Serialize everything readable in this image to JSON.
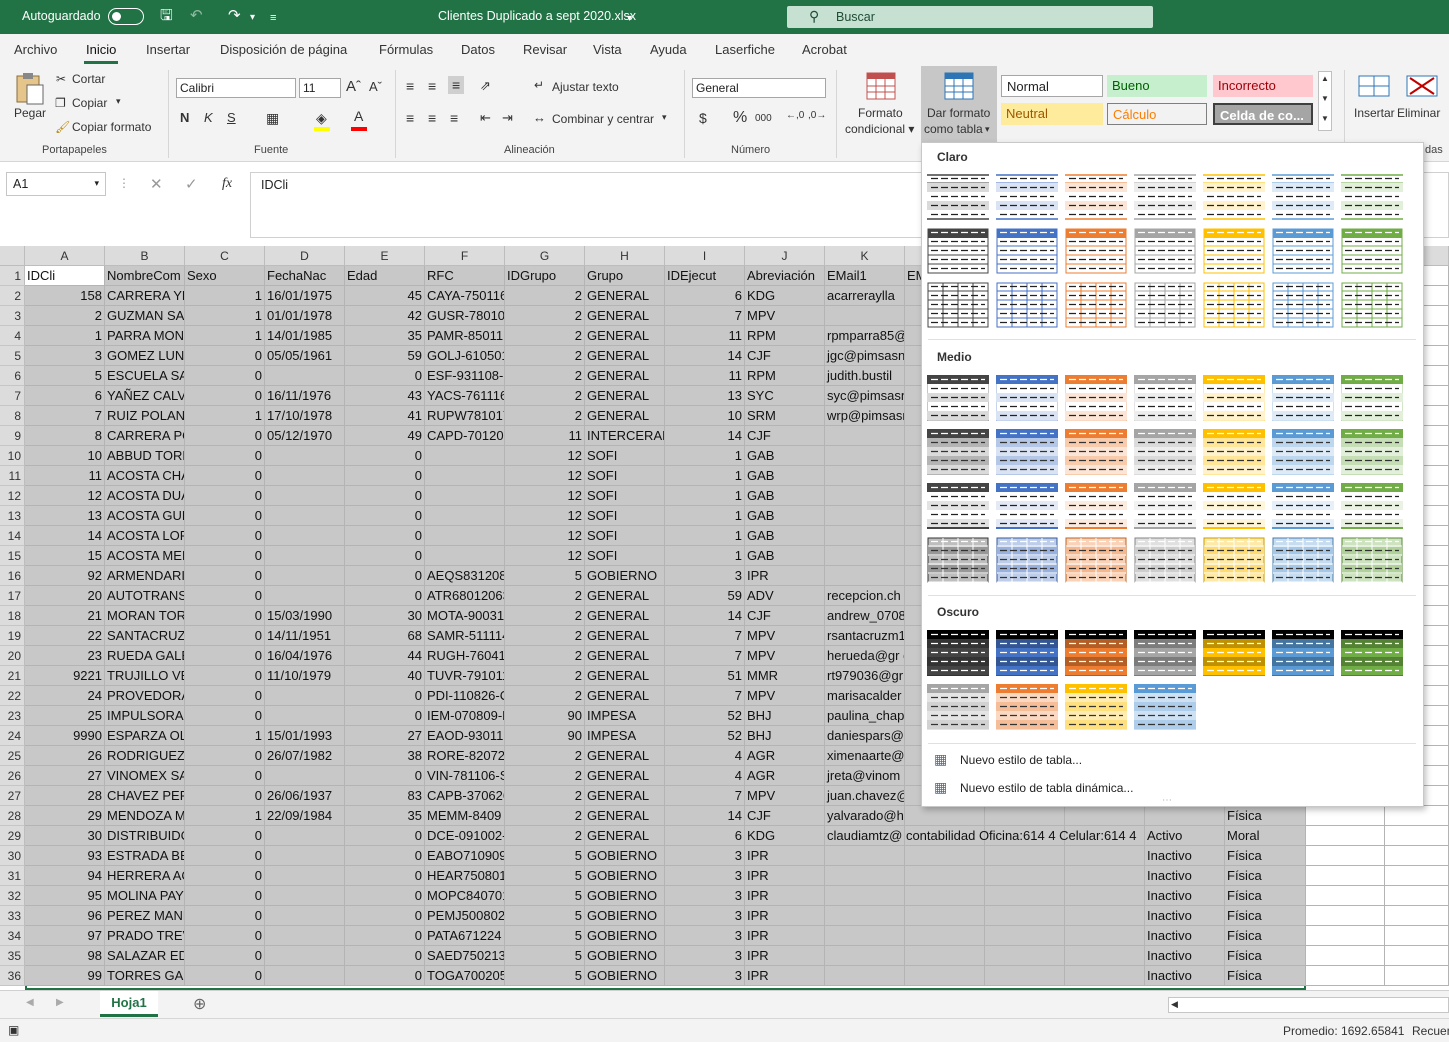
{
  "titlebar": {
    "autosave": "Autoguardado",
    "doc_title": "Clientes Duplicado a sept 2020.xlsx",
    "search": "Buscar"
  },
  "tabs": [
    "Archivo",
    "Inicio",
    "Insertar",
    "Disposición de página",
    "Fórmulas",
    "Datos",
    "Revisar",
    "Vista",
    "Ayuda",
    "Laserfiche",
    "Acrobat"
  ],
  "ribbon": {
    "clipboard": {
      "paste": "Pegar",
      "cut": "Cortar",
      "copy": "Copiar",
      "format_painter": "Copiar formato",
      "label": "Portapapeles"
    },
    "font": {
      "name": "Calibri",
      "size": "11",
      "bold": "N",
      "italic": "K",
      "underline": "S",
      "label": "Fuente"
    },
    "alignment": {
      "wrap": "Ajustar texto",
      "merge": "Combinar y centrar",
      "label": "Alineación"
    },
    "number": {
      "format": "General",
      "currency": "$",
      "percent": "%",
      "thousands": "000",
      "label": "Número"
    },
    "styles": {
      "conditional": "Formato condicional",
      "format_table_1": "Dar formato",
      "format_table_2": "como tabla",
      "normal": "Normal",
      "bueno": "Bueno",
      "incorrecto": "Incorrecto",
      "neutral": "Neutral",
      "calculo": "Cálculo",
      "celda": "Celda de co..."
    },
    "cells": {
      "insert": "Insertar",
      "delete": "Eliminar",
      "label_partial": "das"
    }
  },
  "formula_bar": {
    "name_box": "A1",
    "fx": "fx",
    "content": "IDCli"
  },
  "columns": [
    "A",
    "B",
    "C",
    "D",
    "E",
    "F",
    "G",
    "H",
    "I",
    "J",
    "K"
  ],
  "extra_col": "R",
  "rows": [
    [
      "IDCli",
      "NombreCom",
      "Sexo",
      "FechaNac",
      "Edad",
      "RFC",
      "IDGrupo",
      "Grupo",
      "IDEjecut",
      "Abreviación",
      "EMail1",
      "EM"
    ],
    [
      "158",
      "CARRERA YLL",
      "1",
      "16/01/1975",
      "45",
      "CAYA-750116",
      "2",
      "GENERAL",
      "6",
      "KDG",
      "acarreraylla",
      ""
    ],
    [
      "2",
      "GUZMAN SAI",
      "1",
      "01/01/1978",
      "42",
      "GUSR-780101",
      "2",
      "GENERAL",
      "7",
      "MPV",
      "",
      ""
    ],
    [
      "1",
      "PARRA MON",
      "1",
      "14/01/1985",
      "35",
      "PAMR-85011",
      "2",
      "GENERAL",
      "11",
      "RPM",
      "rpmparra85@rp",
      ""
    ],
    [
      "3",
      "GOMEZ LUNA",
      "0",
      "05/05/1961",
      "59",
      "GOLJ-610501",
      "2",
      "GENERAL",
      "14",
      "CJF",
      "jgc@pimsasnc",
      ""
    ],
    [
      "5",
      "ESCUELA SAN",
      "0",
      "",
      "0",
      "ESF-931108-6",
      "2",
      "GENERAL",
      "11",
      "RPM",
      "judith.bustil",
      ""
    ],
    [
      "6",
      "YAÑEZ CALVI",
      "0",
      "16/11/1976",
      "43",
      "YACS-761116",
      "2",
      "GENERAL",
      "13",
      "SYC",
      "syc@pimsasnc",
      ""
    ],
    [
      "7",
      "RUIZ POLANC",
      "1",
      "17/10/1978",
      "41",
      "RUPW781017",
      "2",
      "GENERAL",
      "10",
      "SRM",
      "wrp@pimsasnc",
      ""
    ],
    [
      "8",
      "CARRERA PO",
      "0",
      "05/12/1970",
      "49",
      "CAPD-701205",
      "11",
      "INTERCERAM",
      "14",
      "CJF",
      "",
      ""
    ],
    [
      "10",
      "ABBUD TORR",
      "0",
      "",
      "0",
      "",
      "12",
      "SOFI",
      "1",
      "GAB",
      "",
      ""
    ],
    [
      "11",
      "ACOSTA CHA",
      "0",
      "",
      "0",
      "",
      "12",
      "SOFI",
      "1",
      "GAB",
      "",
      ""
    ],
    [
      "12",
      "ACOSTA DUA",
      "0",
      "",
      "0",
      "",
      "12",
      "SOFI",
      "1",
      "GAB",
      "",
      ""
    ],
    [
      "13",
      "ACOSTA GUE",
      "0",
      "",
      "0",
      "",
      "12",
      "SOFI",
      "1",
      "GAB",
      "",
      ""
    ],
    [
      "14",
      "ACOSTA LOP",
      "0",
      "",
      "0",
      "",
      "12",
      "SOFI",
      "1",
      "GAB",
      "",
      ""
    ],
    [
      "15",
      "ACOSTA MEI",
      "0",
      "",
      "0",
      "",
      "12",
      "SOFI",
      "1",
      "GAB",
      "",
      ""
    ],
    [
      "92",
      "ARMENDARI",
      "0",
      "",
      "0",
      "AEQS831208",
      "5",
      "GOBIERNO",
      "3",
      "IPR",
      "",
      ""
    ],
    [
      "20",
      "AUTOTRANS",
      "0",
      "",
      "0",
      "ATR68012063",
      "2",
      "GENERAL",
      "59",
      "ADV",
      "recepcion.ch",
      ""
    ],
    [
      "21",
      "MORAN TOR",
      "0",
      "15/03/1990",
      "30",
      "MOTA-90031",
      "2",
      "GENERAL",
      "14",
      "CJF",
      "andrew_0708",
      ""
    ],
    [
      "22",
      "SANTACRUZ",
      "0",
      "14/11/1951",
      "68",
      "SAMR-511114",
      "2",
      "GENERAL",
      "7",
      "MPV",
      "rsantacruzm1",
      ""
    ],
    [
      "23",
      "RUEDA GALE",
      "0",
      "16/04/1976",
      "44",
      "RUGH-760416",
      "2",
      "GENERAL",
      "7",
      "MPV",
      "herueda@gr di",
      ""
    ],
    [
      "9221",
      "TRUJILLO VEI",
      "0",
      "11/10/1979",
      "40",
      "TUVR-791011",
      "2",
      "GENERAL",
      "51",
      "MMR",
      "rt979036@gr RA",
      ""
    ],
    [
      "24",
      "PROVEDORA",
      "0",
      "",
      "0",
      "PDI-110826-C",
      "2",
      "GENERAL",
      "7",
      "MPV",
      "marisacalder",
      ""
    ],
    [
      "25",
      "IMPULSORA",
      "0",
      "",
      "0",
      "IEM-070809-L",
      "90",
      "IMPESA",
      "52",
      "BHJ",
      "paulina_chapa",
      ""
    ],
    [
      "9990",
      "ESPARZA OLI",
      "1",
      "15/01/1993",
      "27",
      "EAOD-930115",
      "90",
      "IMPESA",
      "52",
      "BHJ",
      "daniespars@",
      ""
    ],
    [
      "26",
      "RODRIGUEZ I",
      "0",
      "26/07/1982",
      "38",
      "RORE-820726",
      "2",
      "GENERAL",
      "4",
      "AGR",
      "ximenaarte@",
      ""
    ],
    [
      "27",
      "VINOMEX SA",
      "0",
      "",
      "0",
      "VIN-781106-S",
      "2",
      "GENERAL",
      "4",
      "AGR",
      "jreta@vinom",
      ""
    ],
    [
      "28",
      "CHAVEZ PERI",
      "0",
      "26/06/1937",
      "83",
      "CAPB-370626",
      "2",
      "GENERAL",
      "7",
      "MPV",
      "juan.chavez@",
      ""
    ],
    [
      "29",
      "MENDOZA M",
      "1",
      "22/09/1984",
      "35",
      "MEMM-8409",
      "2",
      "GENERAL",
      "14",
      "CJF",
      "yalvarado@h",
      ""
    ],
    [
      "30",
      "DISTRIBUIDC",
      "0",
      "",
      "0",
      "DCE-091002-",
      "2",
      "GENERAL",
      "6",
      "KDG",
      "claudiamtz@ contabilidad Oficina:614 4 Celular:614 4",
      ""
    ],
    [
      "93",
      "ESTRADA BEJ",
      "0",
      "",
      "0",
      "EABO710909",
      "5",
      "GOBIERNO",
      "3",
      "IPR",
      "",
      ""
    ],
    [
      "94",
      "HERRERA AC",
      "0",
      "",
      "0",
      "HEAR750801",
      "5",
      "GOBIERNO",
      "3",
      "IPR",
      "",
      ""
    ],
    [
      "95",
      "MOLINA PAY",
      "0",
      "",
      "0",
      "MOPC840701",
      "5",
      "GOBIERNO",
      "3",
      "IPR",
      "",
      ""
    ],
    [
      "96",
      "PEREZ MANN",
      "0",
      "",
      "0",
      "PEMJ500802",
      "5",
      "GOBIERNO",
      "3",
      "IPR",
      "",
      ""
    ],
    [
      "97",
      "PRADO TREV",
      "0",
      "",
      "0",
      "PATA671224",
      "5",
      "GOBIERNO",
      "3",
      "IPR",
      "",
      ""
    ],
    [
      "98",
      "SALAZAR EDC",
      "0",
      "",
      "0",
      "SAED750213",
      "5",
      "GOBIERNO",
      "3",
      "IPR",
      "",
      ""
    ],
    [
      "99",
      "TORRES GAR",
      "0",
      "",
      "0",
      "TOGA700205",
      "5",
      "GOBIERNO",
      "3",
      "IPR",
      "",
      ""
    ]
  ],
  "tail_cols": [
    {
      "row": 28,
      "status": "",
      "type": "Física"
    },
    {
      "row": 29,
      "status": "Activo",
      "type": "Moral"
    },
    {
      "row": 30,
      "status": "Inactivo",
      "type": "Física"
    },
    {
      "row": 31,
      "status": "Inactivo",
      "type": "Física"
    },
    {
      "row": 32,
      "status": "Inactivo",
      "type": "Física"
    },
    {
      "row": 33,
      "status": "Inactivo",
      "type": "Física"
    },
    {
      "row": 34,
      "status": "Inactivo",
      "type": "Física"
    },
    {
      "row": 35,
      "status": "Inactivo",
      "type": "Física"
    },
    {
      "row": 36,
      "status": "Inactivo",
      "type": "Física"
    }
  ],
  "gallery": {
    "light": "Claro",
    "medium": "Medio",
    "dark": "Oscuro",
    "new_table_style": "Nuevo estilo de tabla...",
    "new_pivot_style": "Nuevo estilo de tabla dinámica..."
  },
  "palette": [
    "#444444",
    "#4472c4",
    "#ed7d31",
    "#a5a5a5",
    "#ffc000",
    "#5b9bd5",
    "#70ad47"
  ],
  "sheet": {
    "tab": "Hoja1"
  },
  "status": {
    "average": "Promedio: 1692.65841",
    "count_partial": "Recuen"
  }
}
